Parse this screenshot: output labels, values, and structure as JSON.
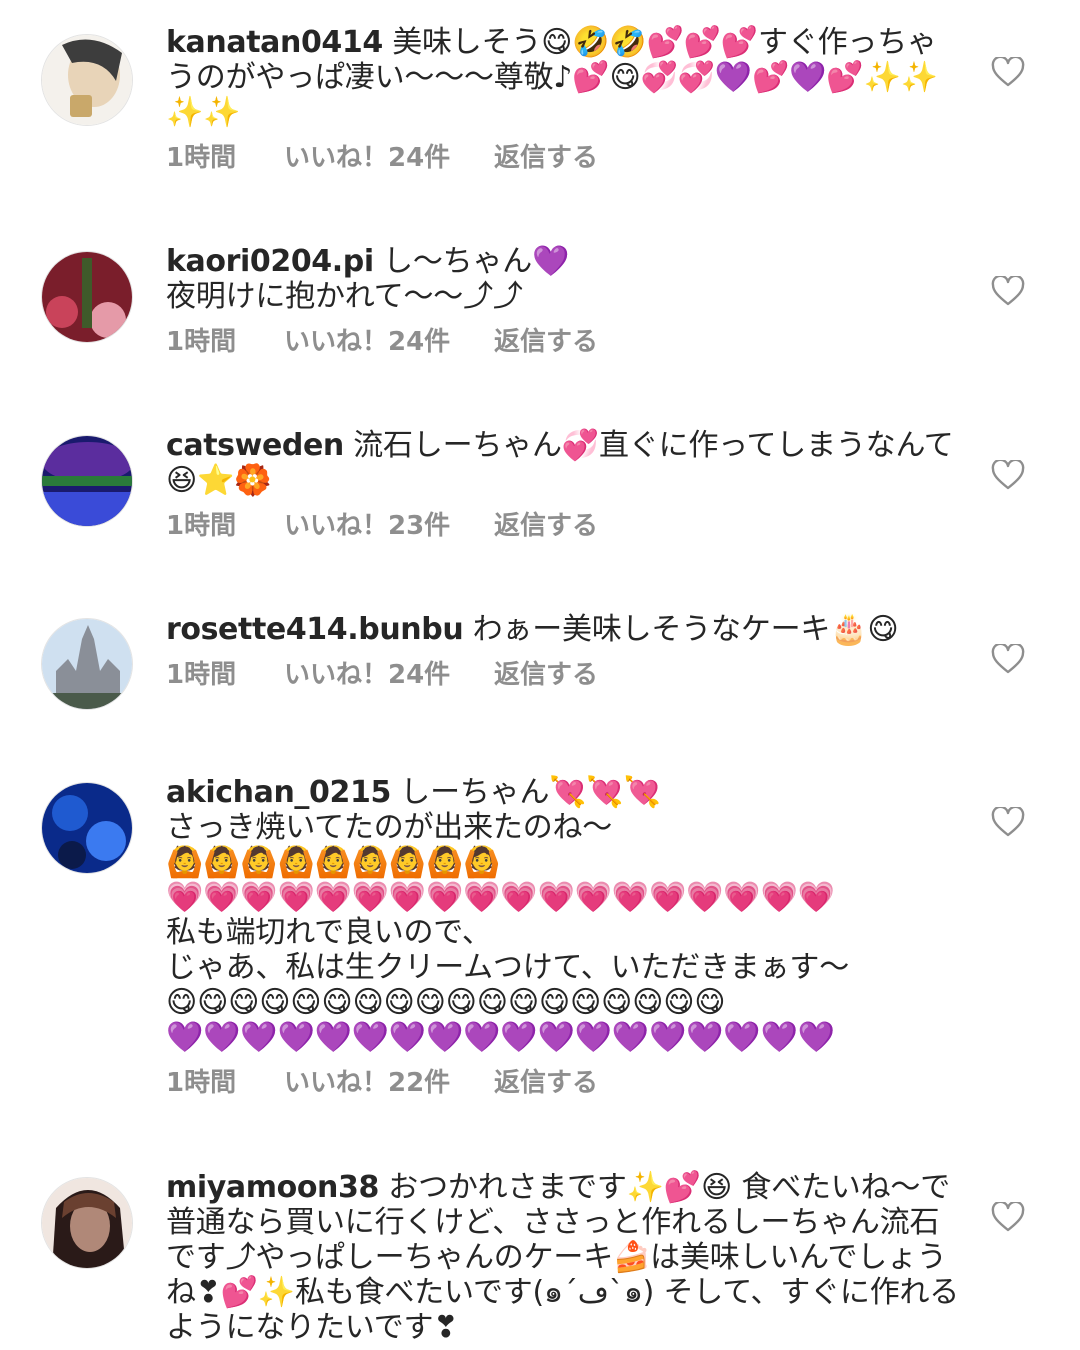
{
  "comments": [
    {
      "username": "kanatan0414",
      "text": "美味しそう😋🤣🤣💕💕💕すぐ作っちゃうのがやっぱ凄い〜〜〜尊敬♪💕😋💞💞💜💕💜💕✨✨✨✨",
      "time": "1時間",
      "likes": "いいね！24件",
      "reply": "返信する",
      "avatar_colors": [
        "#f4f1ec",
        "#c9a86a",
        "#3d3d3d",
        "#e8d4b8"
      ]
    },
    {
      "username": "kaori0204.pi",
      "text": "し〜ちゃん💜\n夜明けに抱かれて〜〜⤴⤴",
      "time": "1時間",
      "likes": "いいね！24件",
      "reply": "返信する",
      "avatar_colors": [
        "#7a1e2b",
        "#c9435a",
        "#3f5a2a",
        "#e59aa8"
      ]
    },
    {
      "username": "catsweden",
      "text": "流石しーちゃん💞直ぐに作ってしまうなんて😆⭐🏵️",
      "time": "1時間",
      "likes": "いいね！23件",
      "reply": "返信する",
      "avatar_colors": [
        "#1a1a6e",
        "#5b2d9e",
        "#2a7a3a",
        "#3a4bd8"
      ]
    },
    {
      "username": "rosette414.bunbu",
      "text": "わぁー美味しそうなケーキ🎂😋",
      "time": "1時間",
      "likes": "いいね！24件",
      "reply": "返信する",
      "avatar_colors": [
        "#cfe0f0",
        "#8a8f98",
        "#4a5a4a",
        "#e8eef5"
      ]
    },
    {
      "username": "akichan_0215",
      "text": "しーちゃん💘💘💘\nさっき焼いてたのが出来たのね〜\n🙆🙆🙆🙆🙆🙆🙆🙆🙆\n💗💗💗💗💗💗💗💗💗💗💗💗💗💗💗💗💗💗\n私も端切れで良いので、\nじゃあ、私は生クリームつけて、いただきまぁす〜\n😋😋😋😋😋😋😋😋😋😋😋😋😋😋😋😋😋😋\n💜💜💜💜💜💜💜💜💜💜💜💜💜💜💜💜💜💜",
      "time": "1時間",
      "likes": "いいね！22件",
      "reply": "返信する",
      "avatar_colors": [
        "#0a2a8a",
        "#1f5ad0",
        "#0b1a4a",
        "#3b7af0"
      ]
    },
    {
      "username": "miyamoon38",
      "text": "おつかれさまです✨💕😆 食べたいね〜で普通なら買いに行くけど、ささっと作れるしーちゃん流石です⤴やっぱしーちゃんのケーキ🍰は美味しいんでしょうね❣💕✨私も食べたいです(๑´ڡ`๑) そして、すぐに作れるようになりたいです❣",
      "time": "",
      "likes": "",
      "reply": "",
      "avatar_colors": [
        "#6a4030",
        "#f0e6e0",
        "#2a1a18",
        "#b08878"
      ]
    }
  ]
}
